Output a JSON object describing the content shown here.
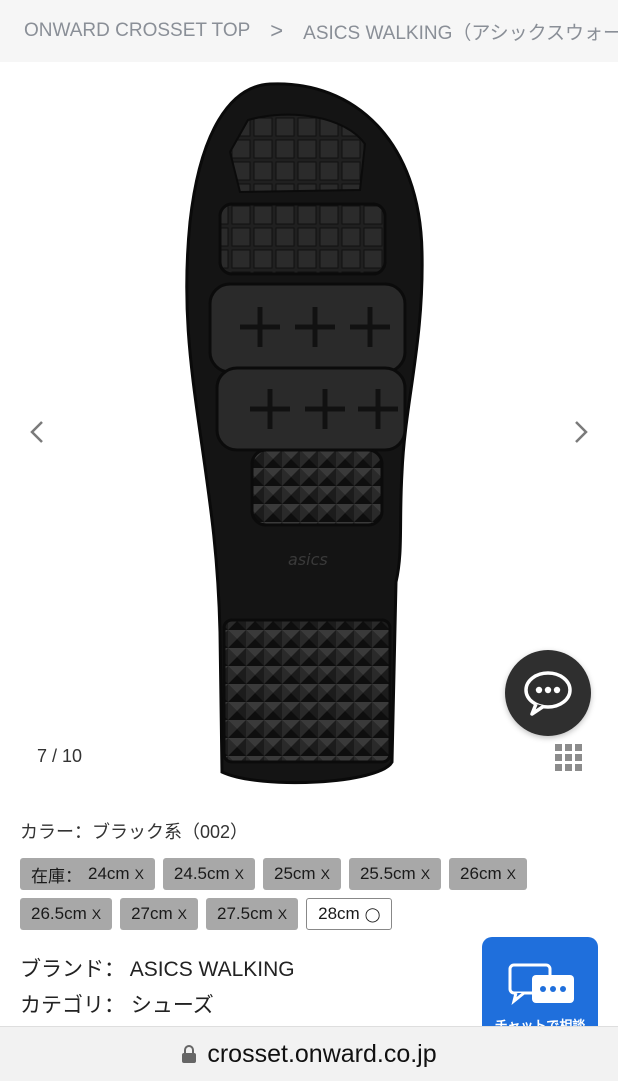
{
  "breadcrumb": {
    "home": "ONWARD CROSSET TOP",
    "separator": ">",
    "current": "ASICS WALKING（アシックスウォー"
  },
  "gallery": {
    "counter": "7 / 10",
    "prev_icon": "chevron-left-icon",
    "next_icon": "chevron-right-icon",
    "image_logo_text": "asics"
  },
  "product": {
    "color_line": "カラー：ブラック系（002）",
    "stock_label": "在庫：",
    "sizes": [
      {
        "label": "24cm",
        "mark": "X",
        "available": false
      },
      {
        "label": "24.5cm",
        "mark": "X",
        "available": false
      },
      {
        "label": "25cm",
        "mark": "X",
        "available": false
      },
      {
        "label": "25.5cm",
        "mark": "X",
        "available": false
      },
      {
        "label": "26cm",
        "mark": "X",
        "available": false
      },
      {
        "label": "26.5cm",
        "mark": "X",
        "available": false
      },
      {
        "label": "27cm",
        "mark": "X",
        "available": false
      },
      {
        "label": "27.5cm",
        "mark": "X",
        "available": false
      },
      {
        "label": "28cm",
        "mark": "◯",
        "available": true
      }
    ],
    "brand_label": "ブランド：",
    "brand_value": "ASICS WALKING",
    "category_label": "カテゴリ：",
    "category_value": "シューズ"
  },
  "chat": {
    "consult_label": "チャットで相談",
    "bubble_icon": "chat-bubble-icon"
  },
  "url_bar": {
    "domain": "crosset.onward.co.jp"
  },
  "colors": {
    "chip_unavailable": "#a8a8a8",
    "chat_consult": "#1f6fdc",
    "breadcrumb_text": "#8a8f97"
  }
}
